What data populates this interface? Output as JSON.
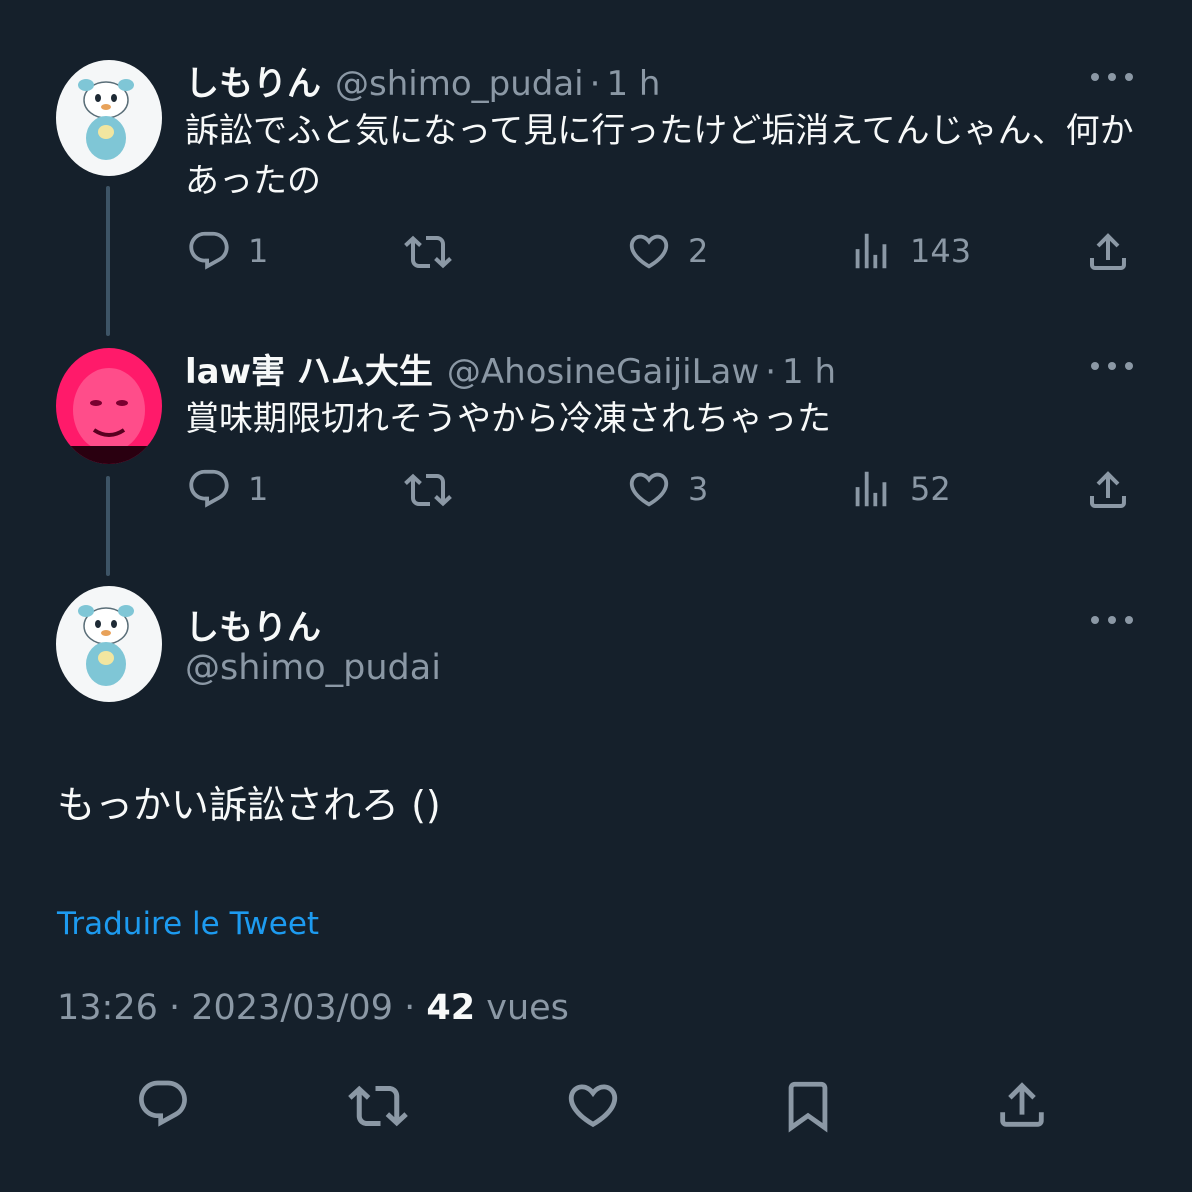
{
  "tweets": [
    {
      "name": "しもりん",
      "handle": "@shimo_pudai",
      "separator": "·",
      "time": "1 h",
      "text_line1": "訴訟でふと気になって見に行ったけど垢消えてんじゃん、何か",
      "text_line2": "あったの",
      "replies": "1",
      "likes": "2",
      "views": "143"
    },
    {
      "name": "law害 ハム大生",
      "handle": "@AhosineGaijiLaw",
      "separator": "·",
      "time": "1 h",
      "text_line1": "賞味期限切れそうやから冷凍されちゃった",
      "replies": "1",
      "likes": "3",
      "views": "52"
    }
  ],
  "main_tweet": {
    "name": "しもりん",
    "handle": "@shimo_pudai",
    "text": "もっかい訴訟されろ ()",
    "translate_label": "Traduire le Tweet",
    "timestamp": "13:26 · 2023/03/09 ·",
    "views_count": "42",
    "views_label": "vues"
  },
  "icons": [
    "reply-icon",
    "retweet-icon",
    "like-icon",
    "views-icon",
    "share-icon",
    "bookmark-icon",
    "more-icon",
    "avatar"
  ],
  "colors": {
    "background": "#15202b",
    "text": "#f7f9f9",
    "muted": "#8b98a5",
    "accent": "#1d9bf0"
  }
}
